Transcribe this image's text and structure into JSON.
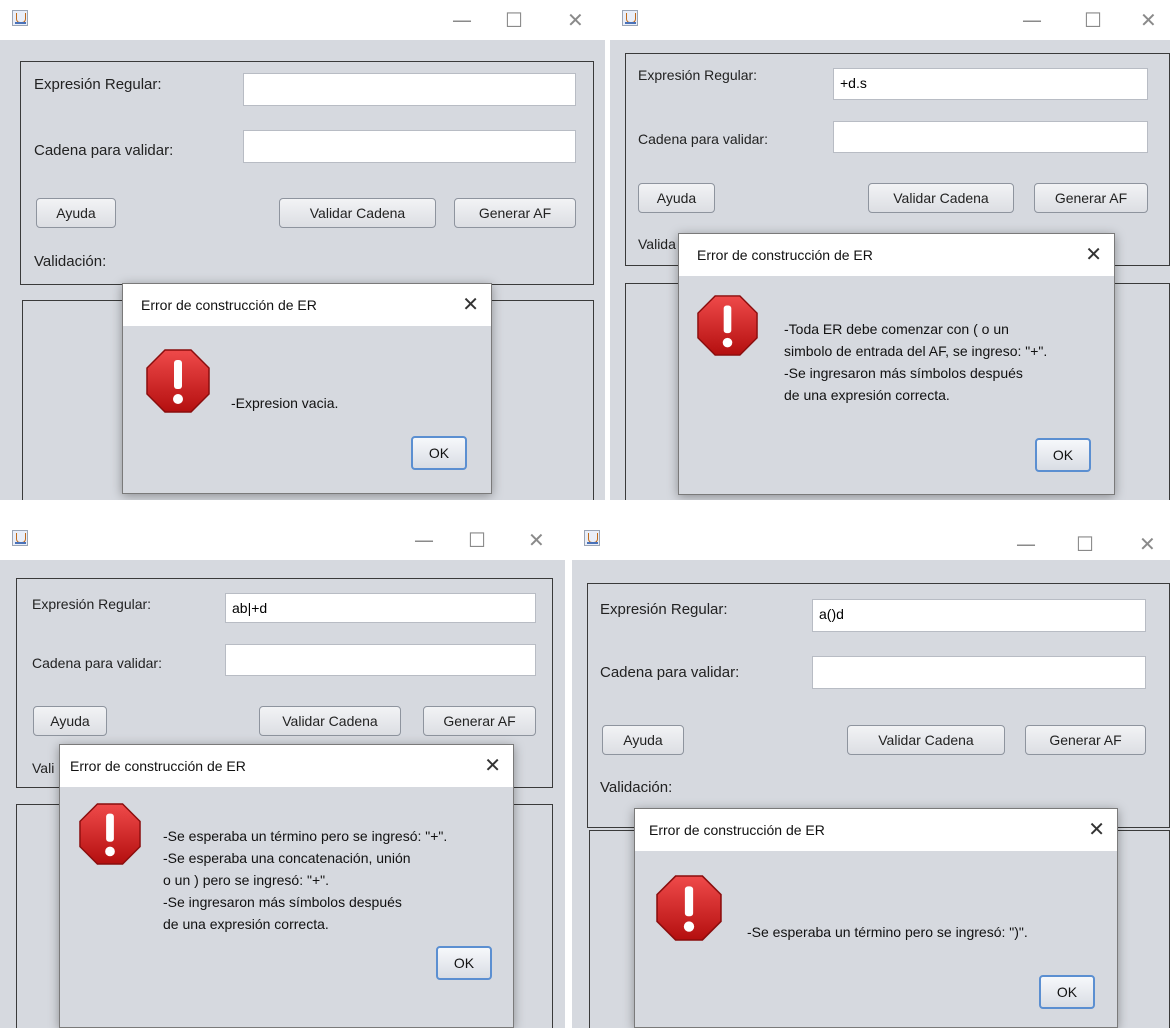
{
  "window_controls": {
    "minimize": "—",
    "maximize": "☐",
    "close": "✕"
  },
  "dialog_close": "✕",
  "icons": {
    "app": "java-app-icon",
    "error": "error-stop-icon"
  },
  "colors": {
    "error_red": "#d62020",
    "ok_border": "#5b8fd1"
  },
  "form_labels": {
    "regex": "Expresión Regular:",
    "string": "Cadena para validar:",
    "help": "Ayuda",
    "validate": "Validar Cadena",
    "generate": "Generar AF",
    "validation": "Validación:"
  },
  "windows": [
    {
      "regex_value": "",
      "string_value": "",
      "validation_visible": "Validación:",
      "dialog": {
        "title": "Error de construcción de ER",
        "lines": [
          "-Expresion vacia."
        ],
        "ok": "OK"
      }
    },
    {
      "regex_value": "+d.s",
      "string_value": "",
      "validation_visible": "Valida",
      "dialog": {
        "title": "Error de construcción de ER",
        "lines": [
          "-Toda ER debe comenzar con ( o un",
          "simbolo de entrada del AF, se ingreso: \"+\".",
          "-Se ingresaron más símbolos después",
          "de una expresión correcta."
        ],
        "ok": "OK"
      }
    },
    {
      "regex_value": "ab|+d",
      "string_value": "",
      "validation_visible": "Vali",
      "dialog": {
        "title": "Error de construcción de ER",
        "lines": [
          "-Se esperaba un término pero se ingresó: \"+\".",
          "-Se esperaba una concatenación, unión",
          "o un ) pero se ingresó: \"+\".",
          "-Se ingresaron más símbolos después",
          "de una expresión correcta."
        ],
        "ok": "OK"
      }
    },
    {
      "regex_value": "a()d",
      "string_value": "",
      "validation_visible": "Validación:",
      "dialog": {
        "title": "Error de construcción de ER",
        "lines": [
          "-Se esperaba un término pero se ingresó: \")\"."
        ],
        "ok": "OK"
      }
    }
  ]
}
